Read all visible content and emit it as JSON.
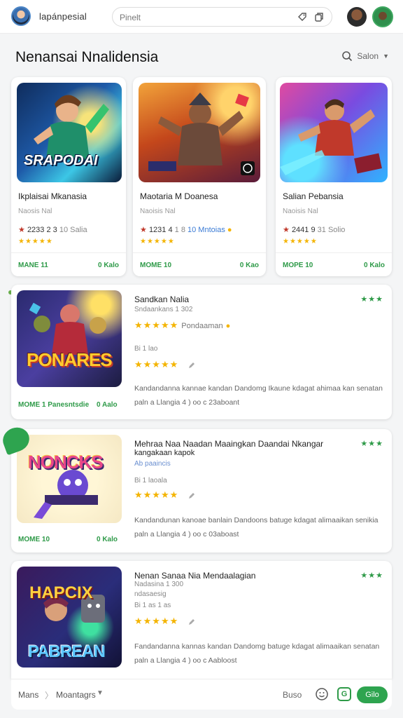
{
  "topbar": {
    "app_name": "lapánpesial",
    "search_placeholder": "Pinelt"
  },
  "section": {
    "title": "Nenansai Nnalidensia",
    "tools_label": "Salon"
  },
  "top_cards": [
    {
      "art_text": "SRAPODAI",
      "title": "Ikplaisai Mkanasia",
      "subtitle": "Naosis Nal",
      "rating_num": "2233 2 3",
      "rating_extra": "10 Salia",
      "stars": "★★★★★",
      "footer_left": "MANE 11",
      "footer_right": "0 Kalo"
    },
    {
      "art_text": "",
      "title": "Maotaria M Doanesa",
      "subtitle": "Naoisis Nal",
      "rating_num": "1231 4",
      "rating_extra": "1 8",
      "rating_link": "10 Mntoias",
      "stars": "★★★★★",
      "footer_left": "MOME 10",
      "footer_right": "0 Kao"
    },
    {
      "art_text": "",
      "title": "Salian Pebansia",
      "subtitle": "Naoisis Nal",
      "rating_num": "2441 9",
      "rating_extra": "31 Solio",
      "stars": "★★★★★",
      "footer_left": "MOPE 10",
      "footer_right": "0 Kalo"
    }
  ],
  "list_cards": [
    {
      "art_text": "PONARES",
      "title": "Sandkan Nalia",
      "subtitle": "Sndaankans 1 302",
      "stars": "★★★★★",
      "stars_extra": "Pondaaman",
      "meta": "Bi 1 lao",
      "stars2": "★★★★★",
      "desc": "Kandandanna kannae kandan Dandomg Ikaune kdagat ahimaa kan senatan paln a Llangia 4 ) oo c 23aboant",
      "green_stars": "★★★",
      "footer_left": "MOME 1 Panesntsdie",
      "footer_right": "0 Aalo"
    },
    {
      "art_text": "NONCKS",
      "title": "Mehraa Naa Naadan Maaingkan Daandai Nkangar",
      "title2": "kangakaan kapok",
      "subtitle": "Ab paaincis",
      "meta": "Bi 1 laoala",
      "stars2": "★★★★★",
      "desc": "Kandandunan kanoae banlain Dandoons batuge kdagat alimaaikan senikia paln a Llangia 4 ) oo c 03aboast",
      "green_stars": "★★★",
      "footer_left": "MOME 10",
      "footer_right": "0 Kalo"
    },
    {
      "art_text": "PABREAN",
      "art_text_top": "HAPCIX",
      "title": "Nenan Sanaa Nia Mendaalagian",
      "subtitle": "Nadasina 1 300",
      "subtitle2": "ndasaesig",
      "meta": "Bi 1 as 1 as",
      "stars2": "★★★★★",
      "desc": "Fandandanna kannas kandan Dandomg batuge kdagat alimaaikan senatan paln a Llangia 4 ) oo c Aabloost",
      "green_stars": "★★★"
    }
  ],
  "bottombar": {
    "home": "Mans",
    "sep": "〉",
    "current": "Moantagrs",
    "link": "Buso",
    "button": "Gilo",
    "g_label": "G"
  },
  "colors": {
    "accent_green": "#2ea44f",
    "star_yellow": "#f4b400"
  }
}
